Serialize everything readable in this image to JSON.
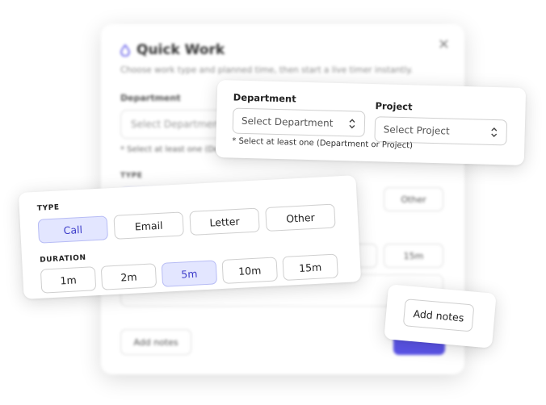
{
  "background_dialog": {
    "title": "Quick Work",
    "subtitle": "Choose work type and planned time, then start a live timer instantly.",
    "department_label": "Department",
    "department_placeholder": "Select Department",
    "hint": "* Select at least one (Department or Project)",
    "type_label": "TYPE",
    "type_other": "Other",
    "duration_15m": "15m",
    "add_notes": "Add notes",
    "close_symbol": "×",
    "accent_color": "#5b54e8"
  },
  "dept_card": {
    "department_label": "Department",
    "department_placeholder": "Select Department",
    "project_label": "Project",
    "project_placeholder": "Select Project",
    "hint": "* Select at least one (Department or Project)"
  },
  "type_card": {
    "type_label": "TYPE",
    "types": [
      {
        "label": "Call",
        "selected": true
      },
      {
        "label": "Email",
        "selected": false
      },
      {
        "label": "Letter",
        "selected": false
      },
      {
        "label": "Other",
        "selected": false
      }
    ],
    "duration_label": "DURATION",
    "durations": [
      {
        "label": "1m",
        "selected": false
      },
      {
        "label": "2m",
        "selected": false
      },
      {
        "label": "5m",
        "selected": true
      },
      {
        "label": "10m",
        "selected": false
      },
      {
        "label": "15m",
        "selected": false
      }
    ]
  },
  "notes_card": {
    "add_notes": "Add notes"
  },
  "colors": {
    "selected_bg": "#e3e6ff",
    "selected_text": "#3c3cc9",
    "primary": "#5b54e8"
  },
  "icons": [
    "water-drop-icon",
    "close-icon",
    "select-chevron-icon"
  ]
}
